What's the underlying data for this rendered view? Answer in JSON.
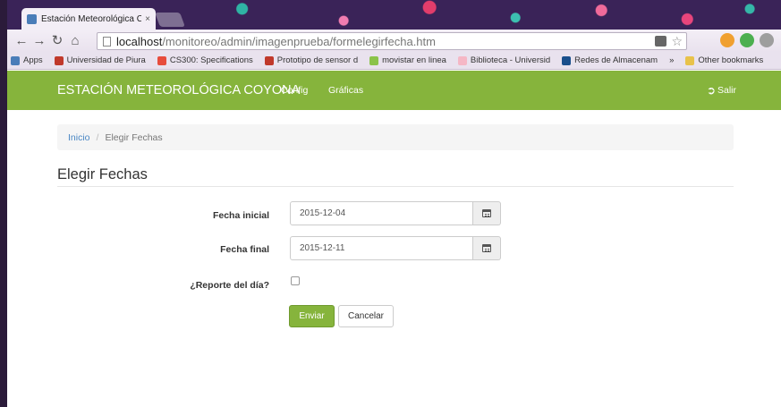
{
  "browser": {
    "tab_title": "Estación Meteorológica C",
    "tab_close": "×",
    "url_host": "localhost",
    "url_path": "/monitoreo/admin/imagenprueba/formelegirfecha.htm",
    "bookmarks": [
      {
        "label": "Apps",
        "color": "#4a7db8"
      },
      {
        "label": "Universidad de Piura",
        "color": "#c0392b"
      },
      {
        "label": "CS300: Specifications",
        "color": "#e74c3c"
      },
      {
        "label": "Prototipo de sensor d",
        "color": "#c0392b"
      },
      {
        "label": "movistar en linea",
        "color": "#8bc34a"
      },
      {
        "label": "Biblioteca - Universid",
        "color": "#f5b7c5"
      },
      {
        "label": "Redes de Almacenam",
        "color": "#1a4f8b"
      }
    ],
    "bookmarks_more": "»",
    "other_bookmarks": "Other bookmarks"
  },
  "navbar": {
    "brand": "ESTACIÓN METEOROLÓGICA COYONA",
    "links": [
      "Config",
      "Gráficas"
    ],
    "logout": "Salir",
    "color": "#86b43c"
  },
  "breadcrumb": {
    "home": "Inicio",
    "separator": "/",
    "current": "Elegir Fechas"
  },
  "page": {
    "title": "Elegir Fechas"
  },
  "form": {
    "fecha_inicial_label": "Fecha inicial",
    "fecha_inicial_value": "2015-12-04",
    "fecha_final_label": "Fecha final",
    "fecha_final_value": "2015-12-11",
    "reporte_label": "¿Reporte del día?",
    "reporte_checked": false,
    "submit_label": "Enviar",
    "cancel_label": "Cancelar"
  }
}
